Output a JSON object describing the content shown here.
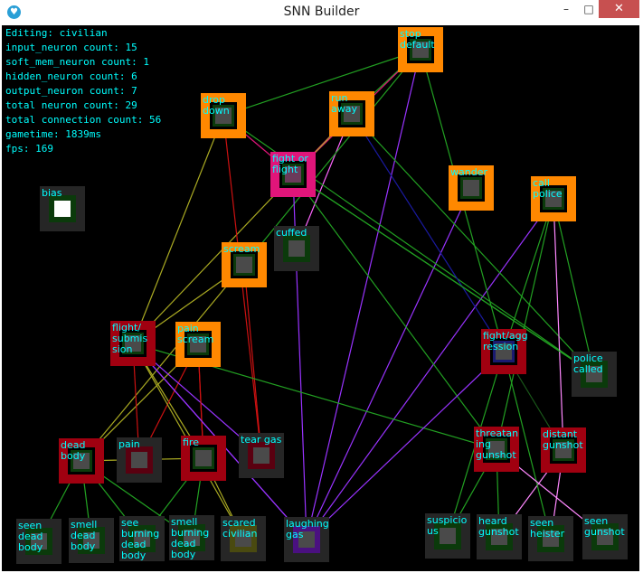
{
  "window": {
    "title": "SNN Builder",
    "minimize_glyph": "–",
    "maximize_glyph": "□",
    "close_glyph": "✕",
    "icon": "heart-app-icon"
  },
  "stats": {
    "editing": "Editing: civilian",
    "input_count": "input_neuron count: 15",
    "soft_mem_count": "soft_mem_neuron count: 1",
    "hidden_count": "hidden_neuron count: 6",
    "output_count": "output_neuron count: 7",
    "total_neuron": "total neuron count: 29",
    "total_connection": "total connection count: 56",
    "gametime": "gametime: 1839ms",
    "fps": "fps: 169"
  },
  "colors": {
    "output": "#ff8800",
    "hidden": "#a00010",
    "input": "#262626",
    "soft_mem": "#e0157a",
    "label": "#00ffff"
  },
  "nodes": [
    {
      "id": "stop_default",
      "label": "stop\ndefault",
      "kind": "output"
    },
    {
      "id": "drop_down",
      "label": "drop\ndown",
      "kind": "output"
    },
    {
      "id": "run_away",
      "label": "run\naway",
      "kind": "output"
    },
    {
      "id": "fight_or_flight",
      "label": "fight or\nflight",
      "kind": "soft_mem"
    },
    {
      "id": "wander",
      "label": "wander",
      "kind": "output"
    },
    {
      "id": "call_police",
      "label": "call\npolice",
      "kind": "output"
    },
    {
      "id": "bias",
      "label": "bias",
      "kind": "bias"
    },
    {
      "id": "scream",
      "label": "scream",
      "kind": "output"
    },
    {
      "id": "cuffed",
      "label": "cuffed",
      "kind": "input"
    },
    {
      "id": "flight_submission",
      "label": "flight/\nsubmis\nsion",
      "kind": "hidden"
    },
    {
      "id": "pain_scream",
      "label": "pain\nscream",
      "kind": "output"
    },
    {
      "id": "fight_aggression",
      "label": "fight/agg\nression",
      "kind": "hidden"
    },
    {
      "id": "police_called",
      "label": "police\ncalled",
      "kind": "input"
    },
    {
      "id": "dead_body",
      "label": "dead\nbody",
      "kind": "hidden"
    },
    {
      "id": "pain",
      "label": "pain",
      "kind": "input"
    },
    {
      "id": "fire",
      "label": "fire",
      "kind": "hidden"
    },
    {
      "id": "tear_gas",
      "label": "tear gas",
      "kind": "input"
    },
    {
      "id": "threatening_gunshot",
      "label": "threatan\ning\ngunshot",
      "kind": "hidden"
    },
    {
      "id": "distant_gunshot",
      "label": "distant\ngunshot",
      "kind": "hidden"
    },
    {
      "id": "seen_dead_body",
      "label": "seen\ndead\nbody",
      "kind": "input"
    },
    {
      "id": "smell_dead_body",
      "label": "smell\ndead\nbody",
      "kind": "input"
    },
    {
      "id": "see_burning_dead_body",
      "label": "see\nburning\ndead\nbody",
      "kind": "input"
    },
    {
      "id": "smell_burning_dead_body",
      "label": "smell\nburning\ndead\nbody",
      "kind": "input"
    },
    {
      "id": "scared_civilian",
      "label": "scared\ncivilian",
      "kind": "input"
    },
    {
      "id": "laughing_gas",
      "label": "laughing\ngas",
      "kind": "input"
    },
    {
      "id": "suspicious",
      "label": "suspicio\nus",
      "kind": "input"
    },
    {
      "id": "heard_gunshot",
      "label": "heard\ngunshot",
      "kind": "input"
    },
    {
      "id": "seen_heister",
      "label": "seen\nheister",
      "kind": "input"
    },
    {
      "id": "seen_gunshot",
      "label": "seen\ngunshot",
      "kind": "input"
    }
  ],
  "connections": [
    {
      "from": "drop_down",
      "to": "stop_default",
      "color": "#22a022"
    },
    {
      "from": "run_away",
      "to": "stop_default",
      "color": "#22a022"
    },
    {
      "from": "fight_or_flight",
      "to": "stop_default",
      "color": "#e0157a"
    },
    {
      "from": "fight_or_flight",
      "to": "run_away",
      "color": "#e0157a"
    },
    {
      "from": "drop_down",
      "to": "fight_or_flight",
      "color": "#e0157a"
    },
    {
      "from": "cuffed",
      "to": "run_away",
      "color": "#ff66ff"
    },
    {
      "from": "scream",
      "to": "stop_default",
      "color": "#22a022"
    },
    {
      "from": "laughing_gas",
      "to": "stop_default",
      "color": "#9933ff"
    },
    {
      "from": "laughing_gas",
      "to": "fight_or_flight",
      "color": "#9933ff"
    },
    {
      "from": "laughing_gas",
      "to": "wander",
      "color": "#9933ff"
    },
    {
      "from": "laughing_gas",
      "to": "call_police",
      "color": "#9933ff"
    },
    {
      "from": "flight_submission",
      "to": "drop_down",
      "color": "#aaaa22"
    },
    {
      "from": "flight_submission",
      "to": "scream",
      "color": "#aaaa22"
    },
    {
      "from": "flight_submission",
      "to": "run_away",
      "color": "#aaaa22"
    },
    {
      "from": "tear_gas",
      "to": "drop_down",
      "color": "#cc1111"
    },
    {
      "from": "tear_gas",
      "to": "scream",
      "color": "#cc1111"
    },
    {
      "from": "dead_body",
      "to": "scream",
      "color": "#aaaa22"
    },
    {
      "from": "dead_body",
      "to": "pain_scream",
      "color": "#aaaa22"
    },
    {
      "from": "fire",
      "to": "flight_submission",
      "color": "#aaaa22"
    },
    {
      "from": "pain",
      "to": "pain_scream",
      "color": "#cc1111"
    },
    {
      "from": "pain",
      "to": "flight_submission",
      "color": "#cc1111"
    },
    {
      "from": "fire",
      "to": "pain_scream",
      "color": "#cc1111"
    },
    {
      "from": "tear_gas",
      "to": "flight_submission",
      "color": "#9933ff"
    },
    {
      "from": "laughing_gas",
      "to": "flight_submission",
      "color": "#9933ff"
    },
    {
      "from": "scared_civilian",
      "to": "flight_submission",
      "color": "#aaaa22"
    },
    {
      "from": "police_called",
      "to": "drop_down",
      "color": "#22a022"
    },
    {
      "from": "police_called",
      "to": "run_away",
      "color": "#22a022"
    },
    {
      "from": "police_called",
      "to": "fight_or_flight",
      "color": "#22a022"
    },
    {
      "from": "police_called",
      "to": "call_police",
      "color": "#22a022"
    },
    {
      "from": "fight_aggression",
      "to": "run_away",
      "color": "#1a1aa0"
    },
    {
      "from": "fight_aggression",
      "to": "stop_default",
      "color": "#22a022"
    },
    {
      "from": "fight_aggression",
      "to": "call_police",
      "color": "#22a022"
    },
    {
      "from": "threatening_gunshot",
      "to": "flight_submission",
      "color": "#22a022"
    },
    {
      "from": "threatening_gunshot",
      "to": "fight_or_flight",
      "color": "#22a022"
    },
    {
      "from": "threatening_gunshot",
      "to": "call_police",
      "color": "#22a022"
    },
    {
      "from": "distant_gunshot",
      "to": "call_police",
      "color": "#ff88ff"
    },
    {
      "from": "distant_gunshot",
      "to": "fight_aggression",
      "color": "#1a5a1a"
    },
    {
      "from": "seen_dead_body",
      "to": "dead_body",
      "color": "#22a022"
    },
    {
      "from": "smell_dead_body",
      "to": "dead_body",
      "color": "#22a022"
    },
    {
      "from": "see_burning_dead_body",
      "to": "dead_body",
      "color": "#22a022"
    },
    {
      "from": "see_burning_dead_body",
      "to": "fire",
      "color": "#22a022"
    },
    {
      "from": "smell_burning_dead_body",
      "to": "fire",
      "color": "#22a022"
    },
    {
      "from": "smell_burning_dead_body",
      "to": "dead_body",
      "color": "#22a022"
    },
    {
      "from": "scared_civilian",
      "to": "fire",
      "color": "#aaaa22"
    },
    {
      "from": "suspicious",
      "to": "fight_aggression",
      "color": "#22a022"
    },
    {
      "from": "heard_gunshot",
      "to": "threatening_gunshot",
      "color": "#22a022"
    },
    {
      "from": "heard_gunshot",
      "to": "distant_gunshot",
      "color": "#ff88ff"
    },
    {
      "from": "seen_heister",
      "to": "fight_aggression",
      "color": "#22a022"
    },
    {
      "from": "seen_heister",
      "to": "distant_gunshot",
      "color": "#ff88ff"
    },
    {
      "from": "seen_gunshot",
      "to": "threatening_gunshot",
      "color": "#ff88ff"
    },
    {
      "from": "laughing_gas",
      "to": "fight_aggression",
      "color": "#9933ff"
    },
    {
      "from": "fight_or_flight",
      "to": "police_called",
      "color": "#22a022"
    },
    {
      "from": "pain_scream",
      "to": "fire",
      "color": "#cc1111"
    },
    {
      "from": "fire",
      "to": "dead_body",
      "color": "#aaaa22"
    },
    {
      "from": "flight_submission",
      "to": "laughing_gas",
      "color": "#9933ff"
    },
    {
      "from": "threatening_gunshot",
      "to": "suspicious",
      "color": "#22a022"
    }
  ]
}
